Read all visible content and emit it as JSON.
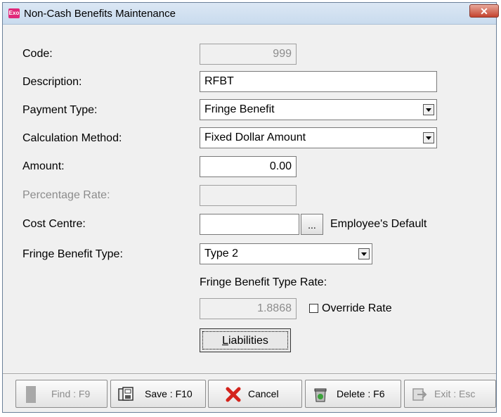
{
  "window": {
    "app_icon_text": "Exo",
    "title": "Non-Cash Benefits Maintenance",
    "close_label": "✕"
  },
  "form": {
    "code_label": "Code:",
    "code_value": "999",
    "description_label": "Description:",
    "description_value": "RFBT",
    "payment_type_label": "Payment Type:",
    "payment_type_value": "Fringe Benefit",
    "calc_method_label": "Calculation Method:",
    "calc_method_value": "Fixed Dollar Amount",
    "amount_label": "Amount:",
    "amount_value": "0.00",
    "percentage_rate_label": "Percentage Rate:",
    "percentage_rate_value": "",
    "cost_centre_label": "Cost Centre:",
    "cost_centre_value": "",
    "cost_centre_browse": "...",
    "cost_centre_hint": "Employee's Default",
    "fbt_type_label": "Fringe Benefit Type:",
    "fbt_type_value": "Type 2",
    "fbt_rate_label": "Fringe Benefit Type Rate:",
    "fbt_rate_value": "1.8868",
    "override_rate_label": "Override Rate",
    "override_rate_checked": false,
    "liabilities_label": "Liabilities"
  },
  "toolbar": {
    "find_label": "Find : F9",
    "save_label": "Save : F10",
    "cancel_label": "Cancel",
    "delete_label": "Delete : F6",
    "exit_label": "Exit : Esc"
  }
}
